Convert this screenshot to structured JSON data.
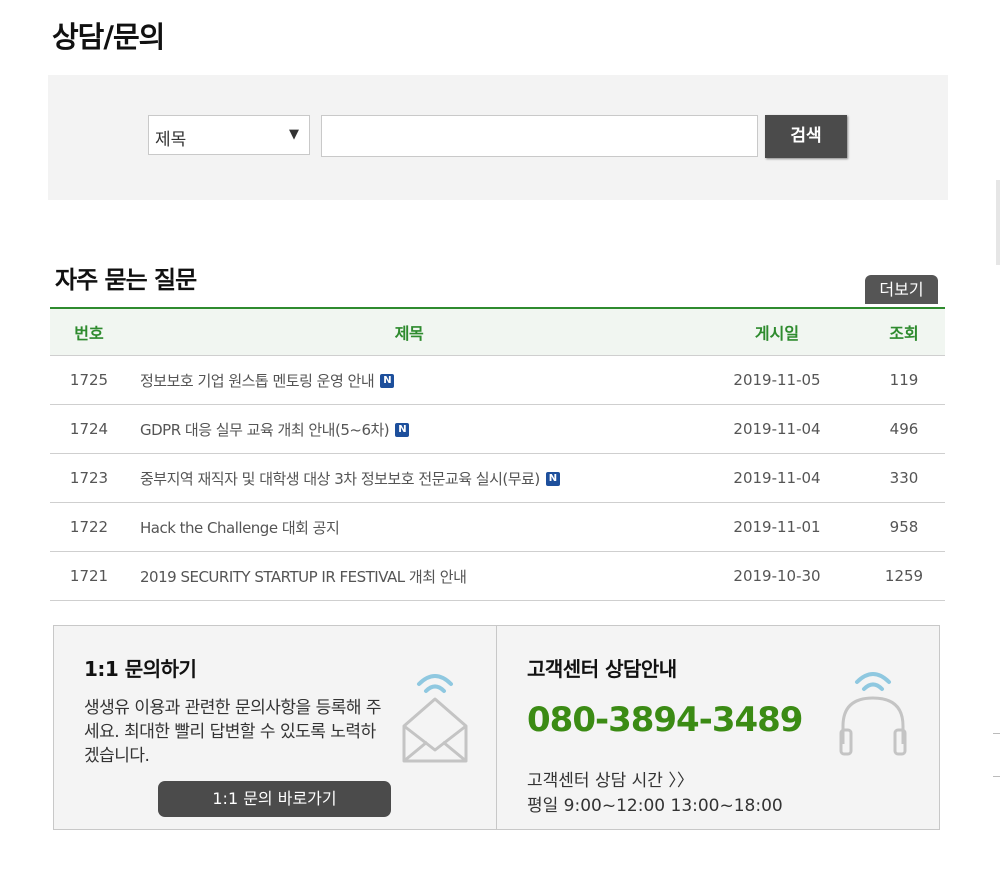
{
  "page": {
    "title": "상담/문의"
  },
  "search": {
    "select_value": "제목",
    "input_value": "",
    "input_placeholder": "",
    "button_label": "검색"
  },
  "faq": {
    "title": "자주 묻는 질문",
    "more_label": "더보기",
    "columns": {
      "no": "번호",
      "title": "제목",
      "date": "게시일",
      "views": "조회"
    },
    "new_badge": "N",
    "rows": [
      {
        "no": "1725",
        "title": "정보보호 기업 원스톱 멘토링 운영 안내",
        "is_new": true,
        "date": "2019-11-05",
        "views": "119"
      },
      {
        "no": "1724",
        "title": "GDPR 대응 실무 교육 개최 안내(5~6차)",
        "is_new": true,
        "date": "2019-11-04",
        "views": "496"
      },
      {
        "no": "1723",
        "title": "중부지역 재직자 및 대학생 대상 3차 정보보호 전문교육 실시(무료)",
        "is_new": true,
        "date": "2019-11-04",
        "views": "330"
      },
      {
        "no": "1722",
        "title": "Hack the Challenge 대회 공지",
        "is_new": false,
        "date": "2019-11-01",
        "views": "958"
      },
      {
        "no": "1721",
        "title": "2019 SECURITY STARTUP IR FESTIVAL 개최 안내",
        "is_new": false,
        "date": "2019-10-30",
        "views": "1259"
      }
    ]
  },
  "inquiry": {
    "heading": "1:1 문의하기",
    "description": "생생유 이용과 관련한 문의사항을 등록해 주세요. 최대한 빨리 답변할 수 있도록 노력하겠습니다.",
    "button_label": "1:1 문의 바로가기",
    "icon": "mail-wifi-icon"
  },
  "support": {
    "heading": "고객센터 상담안내",
    "phone": "080-3894-3489",
    "hours_label": "고객센터 상담 시간 〉〉",
    "hours": "평일 9:00~12:00  13:00~18:00",
    "icon": "headset-icon"
  },
  "colors": {
    "accent_green": "#2e8b2e",
    "phone_green": "#3b8b14",
    "button_dark": "#4b4b4b",
    "badge_blue": "#1d4f9c",
    "icon_blue": "#8fc8e0"
  }
}
